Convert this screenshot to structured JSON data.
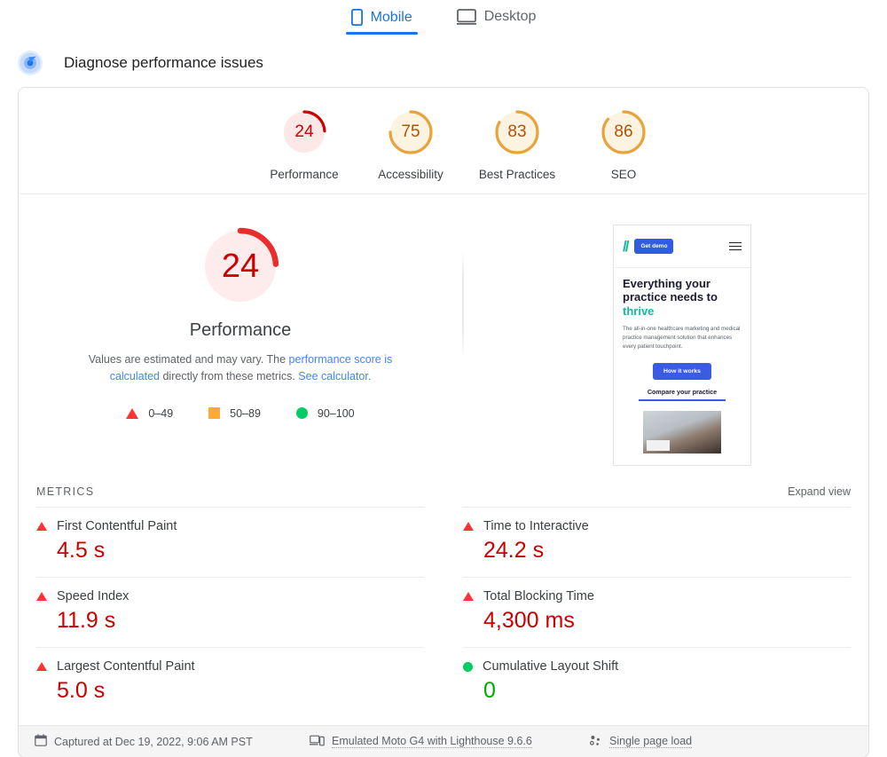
{
  "device_tabs": [
    {
      "label": "Mobile",
      "icon": "phone-icon",
      "active": true
    },
    {
      "label": "Desktop",
      "icon": "monitor-icon",
      "active": false
    }
  ],
  "section": {
    "title": "Diagnose performance issues",
    "icon": "lighthouse-target-icon"
  },
  "scores": [
    {
      "label": "Performance",
      "value": "24",
      "color": "#c00",
      "track": "#fce8e6",
      "pct": 24
    },
    {
      "label": "Accessibility",
      "value": "75",
      "color": "#e8a33d",
      "track": "#fdf3e1",
      "pct": 75
    },
    {
      "label": "Best Practices",
      "value": "83",
      "color": "#e8a33d",
      "track": "#fdf3e1",
      "pct": 83
    },
    {
      "label": "SEO",
      "value": "86",
      "color": "#e8a33d",
      "track": "#fdf3e1",
      "pct": 86
    }
  ],
  "hero": {
    "value": "24",
    "category": "Performance",
    "color": "#e92c2c",
    "track": "#fdeceb",
    "pct": 24,
    "desc_part1": "Values are estimated and may vary. The ",
    "desc_link1": "performance score is calculated",
    "desc_part2": " directly from these metrics. ",
    "desc_link2": "See calculator.",
    "legend": [
      {
        "marker": "triangle",
        "label": "0–49",
        "color": "#f33"
      },
      {
        "marker": "square",
        "label": "50–89",
        "color": "#fa3"
      },
      {
        "marker": "circle",
        "label": "90–100",
        "color": "#0c6"
      }
    ]
  },
  "thumbnail": {
    "logo": "//",
    "cta_button": "Get demo",
    "menu_icon": "hamburger-icon",
    "headline_line1": "Everything your",
    "headline_line2": "practice needs to",
    "headline_accent": "thrive",
    "paragraph": "The all-in-one healthcare marketing and medical practice management solution that enhances every patient touchpoint.",
    "primary_button": "How it works",
    "secondary_link": "Compare your practice"
  },
  "metrics_section": {
    "title": "METRICS",
    "expand_label": "Expand view",
    "items": [
      {
        "name": "First Contentful Paint",
        "value": "4.5 s",
        "status": "bad"
      },
      {
        "name": "Time to Interactive",
        "value": "24.2 s",
        "status": "bad"
      },
      {
        "name": "Speed Index",
        "value": "11.9 s",
        "status": "bad"
      },
      {
        "name": "Total Blocking Time",
        "value": "4,300 ms",
        "status": "bad"
      },
      {
        "name": "Largest Contentful Paint",
        "value": "5.0 s",
        "status": "bad"
      },
      {
        "name": "Cumulative Layout Shift",
        "value": "0",
        "status": "good"
      }
    ]
  },
  "footer": {
    "captured": "Captured at Dec 19, 2022, 9:06 AM PST",
    "emulation": "Emulated Moto G4 with Lighthouse 9.6.6",
    "load": "Single page load",
    "icons": [
      "calendar-icon",
      "devices-icon",
      "page-load-icon"
    ]
  },
  "colors": {
    "accent_blue": "#1a73e8",
    "link_blue": "#4285f4",
    "red": "#c00",
    "orange": "#e8a33d",
    "green": "#0a0"
  }
}
